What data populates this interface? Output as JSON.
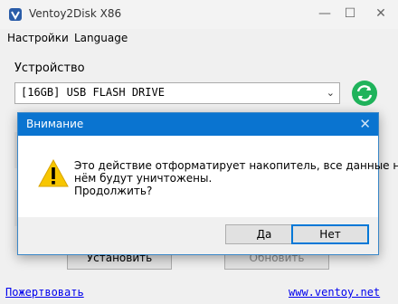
{
  "window": {
    "title": "Ventoy2Disk  X86",
    "minimize_icon": "minimize-icon",
    "maximize_icon": "maximize-icon",
    "close_icon": "close-icon"
  },
  "menu": {
    "settings": "Настройки",
    "language": "Language"
  },
  "device": {
    "label": "Устройство",
    "selected": "[16GB]  USB FLASH DRIVE",
    "refresh_icon": "refresh-icon"
  },
  "buttons": {
    "install": "Установить",
    "update": "Обновить"
  },
  "links": {
    "donate": "Пожертвовать",
    "site": "www.ventoy.net"
  },
  "dialog": {
    "title": "Внимание",
    "message_line1": "Это действие отформатирует накопитель, все данные на",
    "message_line2": "нём будут уничтожены.",
    "message_line3": "Продолжить?",
    "yes": "Да",
    "no": "Нет",
    "icon": "warning-icon"
  },
  "colors": {
    "dialog_title_bg": "#0a74d0",
    "refresh_green": "#1fb35b",
    "link": "#0000ee"
  }
}
